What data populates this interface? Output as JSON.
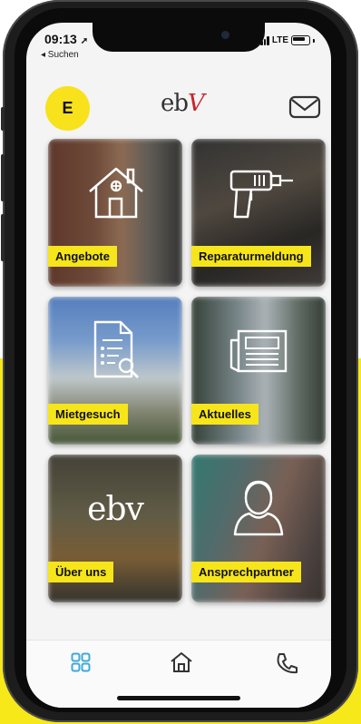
{
  "status_bar": {
    "time": "09:13",
    "back_label": "◂ Suchen",
    "network": "LTE"
  },
  "header": {
    "avatar_letter": "E",
    "logo_main": "eb",
    "logo_accent": "V"
  },
  "tiles": [
    {
      "label": "Angebote",
      "icon": "house-icon"
    },
    {
      "label": "Reparaturmeldung",
      "icon": "drill-icon"
    },
    {
      "label": "Mietgesuch",
      "icon": "document-search-icon"
    },
    {
      "label": "Aktuelles",
      "icon": "newspaper-icon"
    },
    {
      "label": "Über uns",
      "icon": "ebv-logo",
      "logo_text": "ebv"
    },
    {
      "label": "Ansprechpartner",
      "icon": "person-icon"
    }
  ],
  "tabbar": {
    "items": [
      "grid-icon",
      "home-icon",
      "phone-icon"
    ]
  },
  "colors": {
    "brand_yellow": "#f6e51a",
    "logo_red": "#c8232c",
    "tab_active": "#3fa9d9"
  }
}
